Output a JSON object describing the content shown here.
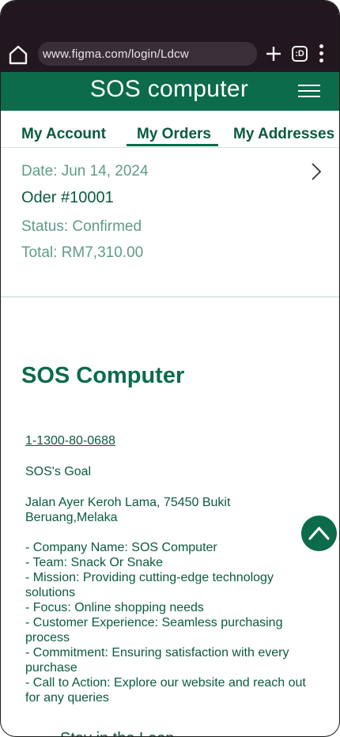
{
  "browser": {
    "url": "www.figma.com/login/Ldcw",
    "tabs_label": ":D"
  },
  "header": {
    "title": "SOS computer"
  },
  "account_tabs": [
    {
      "label": "My Account"
    },
    {
      "label": "My Orders",
      "active": true
    },
    {
      "label": "My Addresses"
    }
  ],
  "order": {
    "date": "Date: Jun 14, 2024",
    "number": "Oder #10001",
    "status": "Status: Confirmed",
    "total": "Total: RM7,310.00"
  },
  "footer": {
    "brand": "SOS Computer",
    "phone": "1-1300-80-0688",
    "goal": "SOS's Goal",
    "address": "Jalan Ayer Keroh Lama, 75450 Bukit Beruang,Melaka",
    "items": [
      "- Company Name: SOS Computer",
      "- Team: Snack Or Snake",
      "- Mission: Providing cutting-edge technology solutions",
      "- Focus: Online shopping needs",
      "- Customer Experience: Seamless purchasing process",
      "- Commitment: Ensuring satisfaction with every purchase",
      "- Call to Action: Explore our website and reach out for any queries"
    ],
    "newsletter_heading": "Stay in the Loop"
  },
  "colors": {
    "brand_green": "#0b6b4b",
    "muted_green": "#5f9d85",
    "chrome_bg": "#22171f"
  }
}
